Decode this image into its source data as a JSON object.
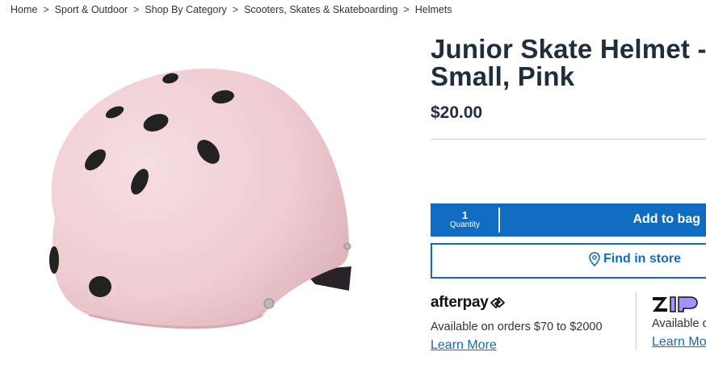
{
  "breadcrumb": [
    "Home",
    "Sport & Outdoor",
    "Shop By Category",
    "Scooters, Skates & Skateboarding",
    "Helmets"
  ],
  "product": {
    "title_line1": "Junior Skate Helmet -",
    "title_line2": "Small, Pink",
    "price": "$20.00",
    "image_color": "#f2d3d8"
  },
  "cart": {
    "quantity_value": "1",
    "quantity_label": "Quantity",
    "add_to_bag": "Add to bag",
    "find_in_store": "Find in store"
  },
  "payments": {
    "afterpay": {
      "logo": "afterpay",
      "text": "Available on orders $70 to $2000",
      "link": "Learn More"
    },
    "zip": {
      "logo": "zip",
      "text": "Available on orders",
      "link": "Learn More"
    }
  },
  "colors": {
    "accent": "#0f6cc0",
    "title": "#1f2d3d",
    "zip_purple": "#aa8fff"
  }
}
